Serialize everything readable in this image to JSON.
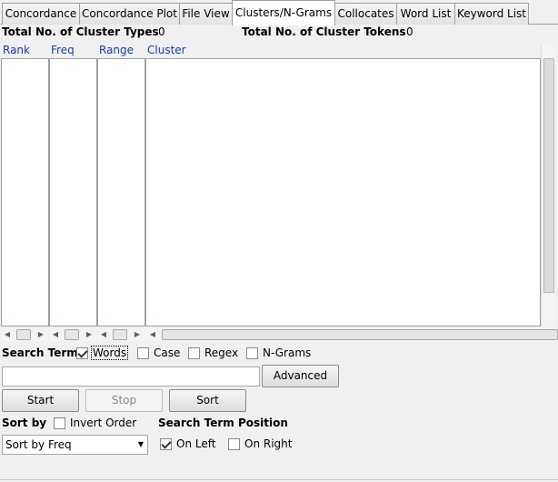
{
  "tabs": [
    {
      "label": "Concordance",
      "active": false
    },
    {
      "label": "Concordance Plot",
      "active": false
    },
    {
      "label": "File View",
      "active": false
    },
    {
      "label": "Clusters/N-Grams",
      "active": true
    },
    {
      "label": "Collocates",
      "active": false
    },
    {
      "label": "Word List",
      "active": false
    },
    {
      "label": "Keyword List",
      "active": false
    }
  ],
  "stats": {
    "types_label": "Total No. of Cluster Types",
    "types_value": "0",
    "tokens_label": "Total No. of Cluster Tokens",
    "tokens_value": "0"
  },
  "columns": {
    "rank": "Rank",
    "freq": "Freq",
    "range": "Range",
    "cluster": "Cluster"
  },
  "search": {
    "label": "Search Term",
    "words": {
      "label": "Words",
      "checked": true
    },
    "case": {
      "label": "Case",
      "checked": false
    },
    "regex": {
      "label": "Regex",
      "checked": false
    },
    "ngrams": {
      "label": "N-Grams",
      "checked": false
    },
    "input_value": "",
    "advanced_label": "Advanced"
  },
  "actions": {
    "start_label": "Start",
    "stop_label": "Stop",
    "sort_label": "Sort"
  },
  "sort": {
    "label": "Sort by",
    "invert": {
      "label": "Invert Order",
      "checked": false
    },
    "selected": "Sort by Freq"
  },
  "position": {
    "label": "Search Term Position",
    "on_left": {
      "label": "On Left",
      "checked": true
    },
    "on_right": {
      "label": "On Right",
      "checked": false
    }
  },
  "icons": {
    "left_arrow": "◀",
    "right_arrow": "▶",
    "dropdown": "▼"
  }
}
